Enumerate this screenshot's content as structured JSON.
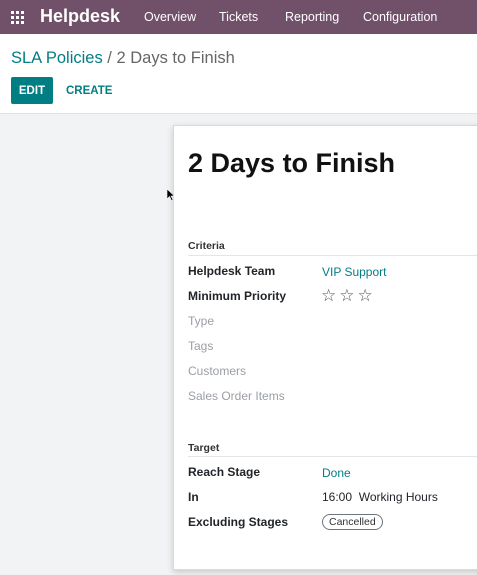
{
  "navbar": {
    "app_name": "Helpdesk",
    "menu": [
      "Overview",
      "Tickets",
      "Reporting",
      "Configuration"
    ]
  },
  "breadcrumb": {
    "parent": "SLA Policies",
    "separator": " / ",
    "current": "2 Days to Finish"
  },
  "buttons": {
    "edit": "EDIT",
    "create": "CREATE"
  },
  "record": {
    "title": "2 Days to Finish",
    "criteria": {
      "section_title": "Criteria",
      "helpdesk_team_label": "Helpdesk Team",
      "helpdesk_team_value": "VIP Support",
      "minimum_priority_label": "Minimum Priority",
      "priority_stars": "☆☆☆",
      "priority_level": 0,
      "priority_max": 3,
      "type_label": "Type",
      "tags_label": "Tags",
      "customers_label": "Customers",
      "sales_order_items_label": "Sales Order Items"
    },
    "target": {
      "section_title": "Target",
      "reach_stage_label": "Reach Stage",
      "reach_stage_value": "Done",
      "in_label": "In",
      "in_value": "16:00",
      "in_unit": "Working Hours",
      "excluding_stages_label": "Excluding Stages",
      "excluding_stages_tag": "Cancelled"
    }
  },
  "colors": {
    "navbar": "#71506a",
    "primary": "#017e84",
    "background": "#f2f3f4",
    "muted_label": "#9a9ea3"
  }
}
